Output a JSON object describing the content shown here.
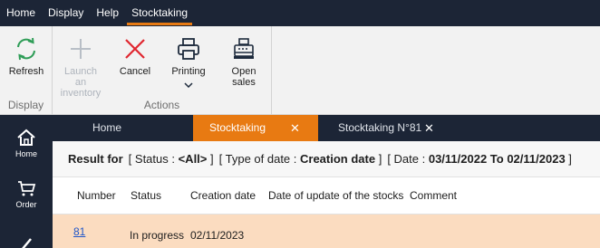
{
  "menu": {
    "items": [
      {
        "label": "Home"
      },
      {
        "label": "Display"
      },
      {
        "label": "Help"
      },
      {
        "label": "Stocktaking"
      }
    ]
  },
  "ribbon": {
    "refresh_label": "Refresh",
    "launch_label_line1": "Launch an",
    "launch_label_line2": "inventory",
    "cancel_label": "Cancel",
    "printing_label": "Printing",
    "open_sales_line1": "Open",
    "open_sales_line2": "sales",
    "group_display": "Display",
    "group_actions": "Actions"
  },
  "sidebar": {
    "items": [
      {
        "label": "Home",
        "icon": "home-icon"
      },
      {
        "label": "Order",
        "icon": "cart-icon"
      }
    ]
  },
  "tabs": [
    {
      "label": "Home"
    },
    {
      "label": "Stocktaking",
      "close": "✕"
    },
    {
      "label": "Stocktaking N°81",
      "close": "✕"
    }
  ],
  "result": {
    "prefix": "Result for",
    "status_open": "[ Status : ",
    "status_value": "<All>",
    "status_close": " ]",
    "datetype_open": "[ Type of date : ",
    "datetype_value": "Creation date",
    "datetype_close": " ]",
    "date_open": "[ Date : ",
    "date_value": "03/11/2022 To 02/11/2023",
    "date_close": " ]"
  },
  "table": {
    "columns": [
      "Number",
      "Status",
      "Creation date",
      "Date of update of the stocks",
      "Comment"
    ],
    "rows": [
      {
        "number": "81",
        "status": "In progress",
        "creation_date": "02/11/2023",
        "update_date": "",
        "comment": ""
      }
    ]
  },
  "colors": {
    "accent": "#e87a12",
    "navy": "#1c2536",
    "row_highlight": "#fbdcc0",
    "cancel_red": "#e0262f",
    "refresh_green": "#2f9d57"
  }
}
